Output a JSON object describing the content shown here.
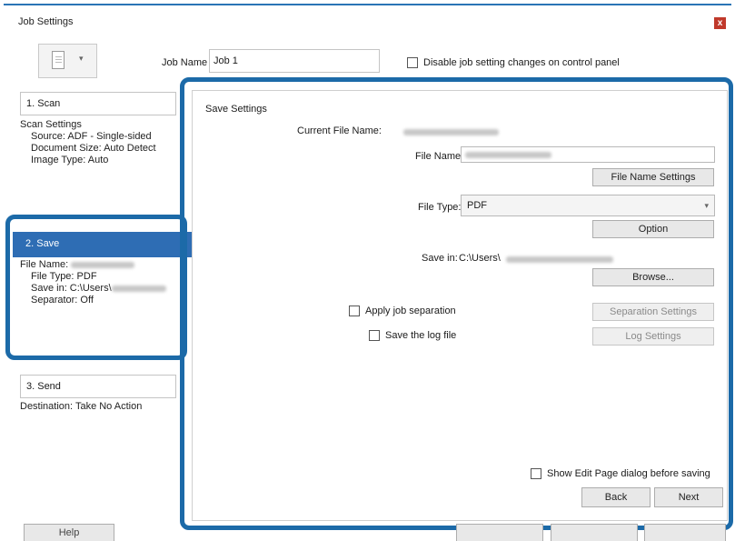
{
  "window": {
    "title": "Job Settings",
    "close_glyph": "x"
  },
  "header": {
    "job_name_label": "Job Name",
    "job_name_value": "Job 1",
    "disable_label": "Disable job setting changes on control panel"
  },
  "steps": {
    "scan": {
      "tab_label": "1. Scan",
      "summary_title": "Scan Settings",
      "source": "Source: ADF - Single-sided",
      "document_size": "Document Size: Auto Detect",
      "image_type": "Image Type: Auto"
    },
    "save": {
      "tab_label": "2. Save",
      "file_name": "File Name:",
      "file_type": "File Type: PDF",
      "save_in": "Save in: C:\\Users\\",
      "separator": "Separator: Off"
    },
    "send": {
      "tab_label": "3. Send",
      "destination": "Destination: Take No Action"
    }
  },
  "save_settings": {
    "section_title": "Save Settings",
    "current_file_name_label": "Current File Name:",
    "file_name_label": "File Name:",
    "file_name_settings_button": "File Name Settings",
    "file_type_label": "File Type:",
    "file_type_value": "PDF",
    "option_button": "Option",
    "save_in_label": "Save in:",
    "save_in_value": "C:\\Users\\",
    "browse_button": "Browse...",
    "apply_job_separation_label": "Apply job separation",
    "separation_settings_button": "Separation Settings",
    "save_log_label": "Save the log file",
    "log_settings_button": "Log Settings",
    "show_edit_page_label": "Show Edit Page dialog before saving",
    "back_button": "Back",
    "next_button": "Next"
  },
  "footer": {
    "help_button": "Help"
  },
  "colors": {
    "highlight": "#1c6aa8",
    "selected_step": "#2e6db4",
    "close_button": "#c0392b"
  }
}
